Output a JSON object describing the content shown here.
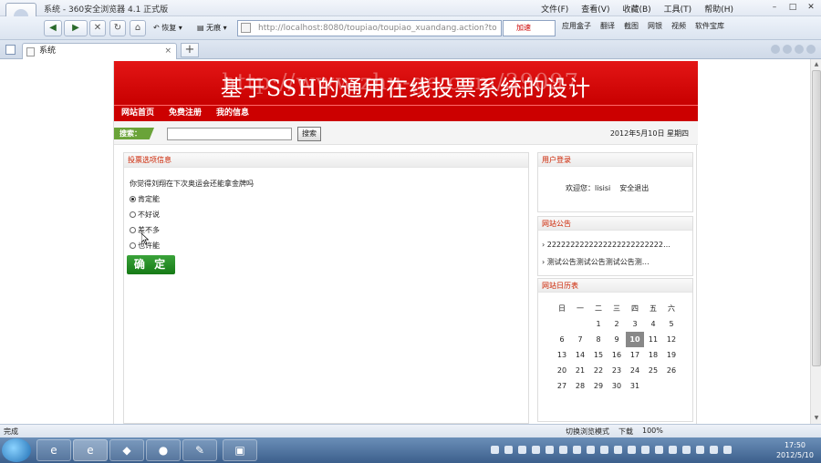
{
  "browser": {
    "window_title": "系统 - 360安全浏览器 4.1 正式版",
    "menu": [
      "文件(F)",
      "查看(V)",
      "收藏(B)",
      "工具(T)",
      "帮助(H)"
    ],
    "toolbar": {
      "back": "◀",
      "forward": "▶",
      "stop": "✕",
      "refresh": "↻",
      "home": "⌂",
      "restore_label": "恢复",
      "no_trace_label": "无痕",
      "address": "http://localhost:8080/toupiao/toupiao_xuandang.action?to",
      "speedup_label": "加速",
      "right_tools": [
        "应用盒子",
        "翻译",
        "截图",
        "网银",
        "视频",
        "软件宝库"
      ]
    },
    "tab": {
      "title": "系统",
      "close": "×",
      "new_tab": "+"
    },
    "status_text": "完成",
    "status_right": [
      "切换浏览模式",
      "下载",
      "100%"
    ]
  },
  "site": {
    "banner_title": "基于SSH的通用在线投票系统的设计",
    "banner_shadow": "http://www.zhu-ge.com/39097",
    "nav": [
      "网站首页",
      "免费注册",
      "我的信息"
    ],
    "search_label": "搜索：",
    "search_value": "",
    "search_button": "搜索",
    "date": "2012年5月10日 星期四",
    "poll": {
      "panel_title": "投票选项信息",
      "question": "你觉得刘翔在下次奥运会还能拿金牌吗",
      "options": [
        {
          "label": "肯定能",
          "checked": true
        },
        {
          "label": "不好说",
          "checked": false
        },
        {
          "label": "差不多",
          "checked": false
        },
        {
          "label": "也许能",
          "checked": false
        }
      ],
      "submit_label": "确 定"
    },
    "login": {
      "panel_title": "用户登录",
      "welcome": "欢迎您：",
      "username": "lisisi",
      "logout": "安全退出"
    },
    "notice": {
      "panel_title": "网站公告",
      "items": [
        "› 2222222222222222222222222…",
        "› 测试公告测试公告测试公告测…"
      ]
    },
    "calendar": {
      "panel_title": "网站日历表",
      "weekdays": [
        "日",
        "一",
        "二",
        "三",
        "四",
        "五",
        "六"
      ],
      "weeks": [
        [
          "",
          "",
          "1",
          "2",
          "3",
          "4",
          "5"
        ],
        [
          "6",
          "7",
          "8",
          "9",
          "10",
          "11",
          "12"
        ],
        [
          "13",
          "14",
          "15",
          "16",
          "17",
          "18",
          "19"
        ],
        [
          "20",
          "21",
          "22",
          "23",
          "24",
          "25",
          "26"
        ],
        [
          "27",
          "28",
          "29",
          "30",
          "31",
          "",
          ""
        ]
      ],
      "today": "10"
    }
  },
  "taskbar": {
    "apps": [
      "ie-icon",
      "360-browser-icon",
      "paint-icon",
      "media-icon",
      "editor-icon",
      "tool-icon"
    ],
    "clock_time": "17:50",
    "clock_date": "2012/5/10"
  }
}
